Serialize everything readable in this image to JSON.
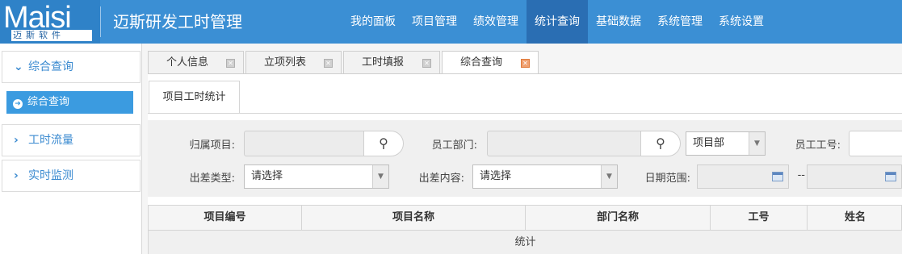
{
  "brand": {
    "logo_text": "Maisi",
    "logo_sub": "迈斯软件",
    "app_title": "迈斯研发工时管理"
  },
  "topnav": [
    {
      "label": "我的面板",
      "active": false
    },
    {
      "label": "项目管理",
      "active": false
    },
    {
      "label": "绩效管理",
      "active": false
    },
    {
      "label": "统计查询",
      "active": true
    },
    {
      "label": "基础数据",
      "active": false
    },
    {
      "label": "系统管理",
      "active": false
    },
    {
      "label": "系统设置",
      "active": false
    }
  ],
  "sidebar": {
    "groups": [
      {
        "label": "综合查询",
        "expanded": true
      },
      {
        "label": "工时流量",
        "expanded": false
      },
      {
        "label": "实时监测",
        "expanded": false
      }
    ],
    "active_item": "综合查询"
  },
  "tabs": [
    {
      "label": "个人信息",
      "active": false
    },
    {
      "label": "立项列表",
      "active": false
    },
    {
      "label": "工时填报",
      "active": false
    },
    {
      "label": "综合查询",
      "active": true
    }
  ],
  "subtab": "项目工时统计",
  "filters": {
    "project_label": "归属项目:",
    "dept_label": "员工部门:",
    "dept_type_value": "项目部",
    "emp_no_label": "员工工号:",
    "trip_type_label": "出差类型:",
    "trip_type_value": "请选择",
    "trip_content_label": "出差内容:",
    "trip_content_value": "请选择",
    "date_range_label": "日期范围:",
    "date_sep": "--"
  },
  "table": {
    "columns": [
      "项目编号",
      "项目名称",
      "部门名称",
      "工号",
      "姓名"
    ],
    "summary_label": "统计"
  },
  "colors": {
    "header_bg": "#3b8fd4",
    "nav_active": "#2a6eb3",
    "sidebar_active": "#3b9be0",
    "accent": "#3a8ad0"
  }
}
